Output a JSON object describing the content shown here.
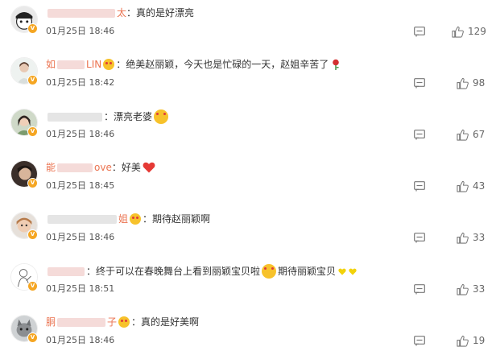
{
  "icons": {
    "reply": "comment-icon",
    "like": "thumbs-up-icon",
    "verified": "v-badge-icon"
  },
  "colors": {
    "username": "#eb7350",
    "badge": "#f5a623",
    "text": "#333333",
    "meta": "#555555"
  },
  "comments": [
    {
      "user_suffix": "太",
      "text": "：真的是好漂亮",
      "time": "01月25日 18:46",
      "likes": "129"
    },
    {
      "user_prefix": "如",
      "user_suffix": "LIN",
      "text": "：绝美赵丽颖，今天也是忙碌的一天，赵姐辛苦了",
      "time": "01月25日 18:42",
      "likes": "98"
    },
    {
      "text": "：漂亮老婆",
      "time": "01月25日 18:46",
      "likes": "67"
    },
    {
      "user_prefix": "能",
      "user_suffix": "ove",
      "text": "：好美",
      "time": "01月25日 18:45",
      "likes": "43"
    },
    {
      "user_suffix": "姐",
      "text": "：期待赵丽颖啊",
      "time": "01月25日 18:46",
      "likes": "33"
    },
    {
      "text_a": "：终于可以在春晚舞台上看到丽颖宝贝啦",
      "text_b": "期待丽颖宝贝",
      "time": "01月25日 18:51",
      "likes": "33"
    },
    {
      "user_prefix": "胴",
      "user_suffix": "子",
      "text": "：真的是好美啊",
      "time": "01月25日 18:46",
      "likes": "19"
    }
  ]
}
